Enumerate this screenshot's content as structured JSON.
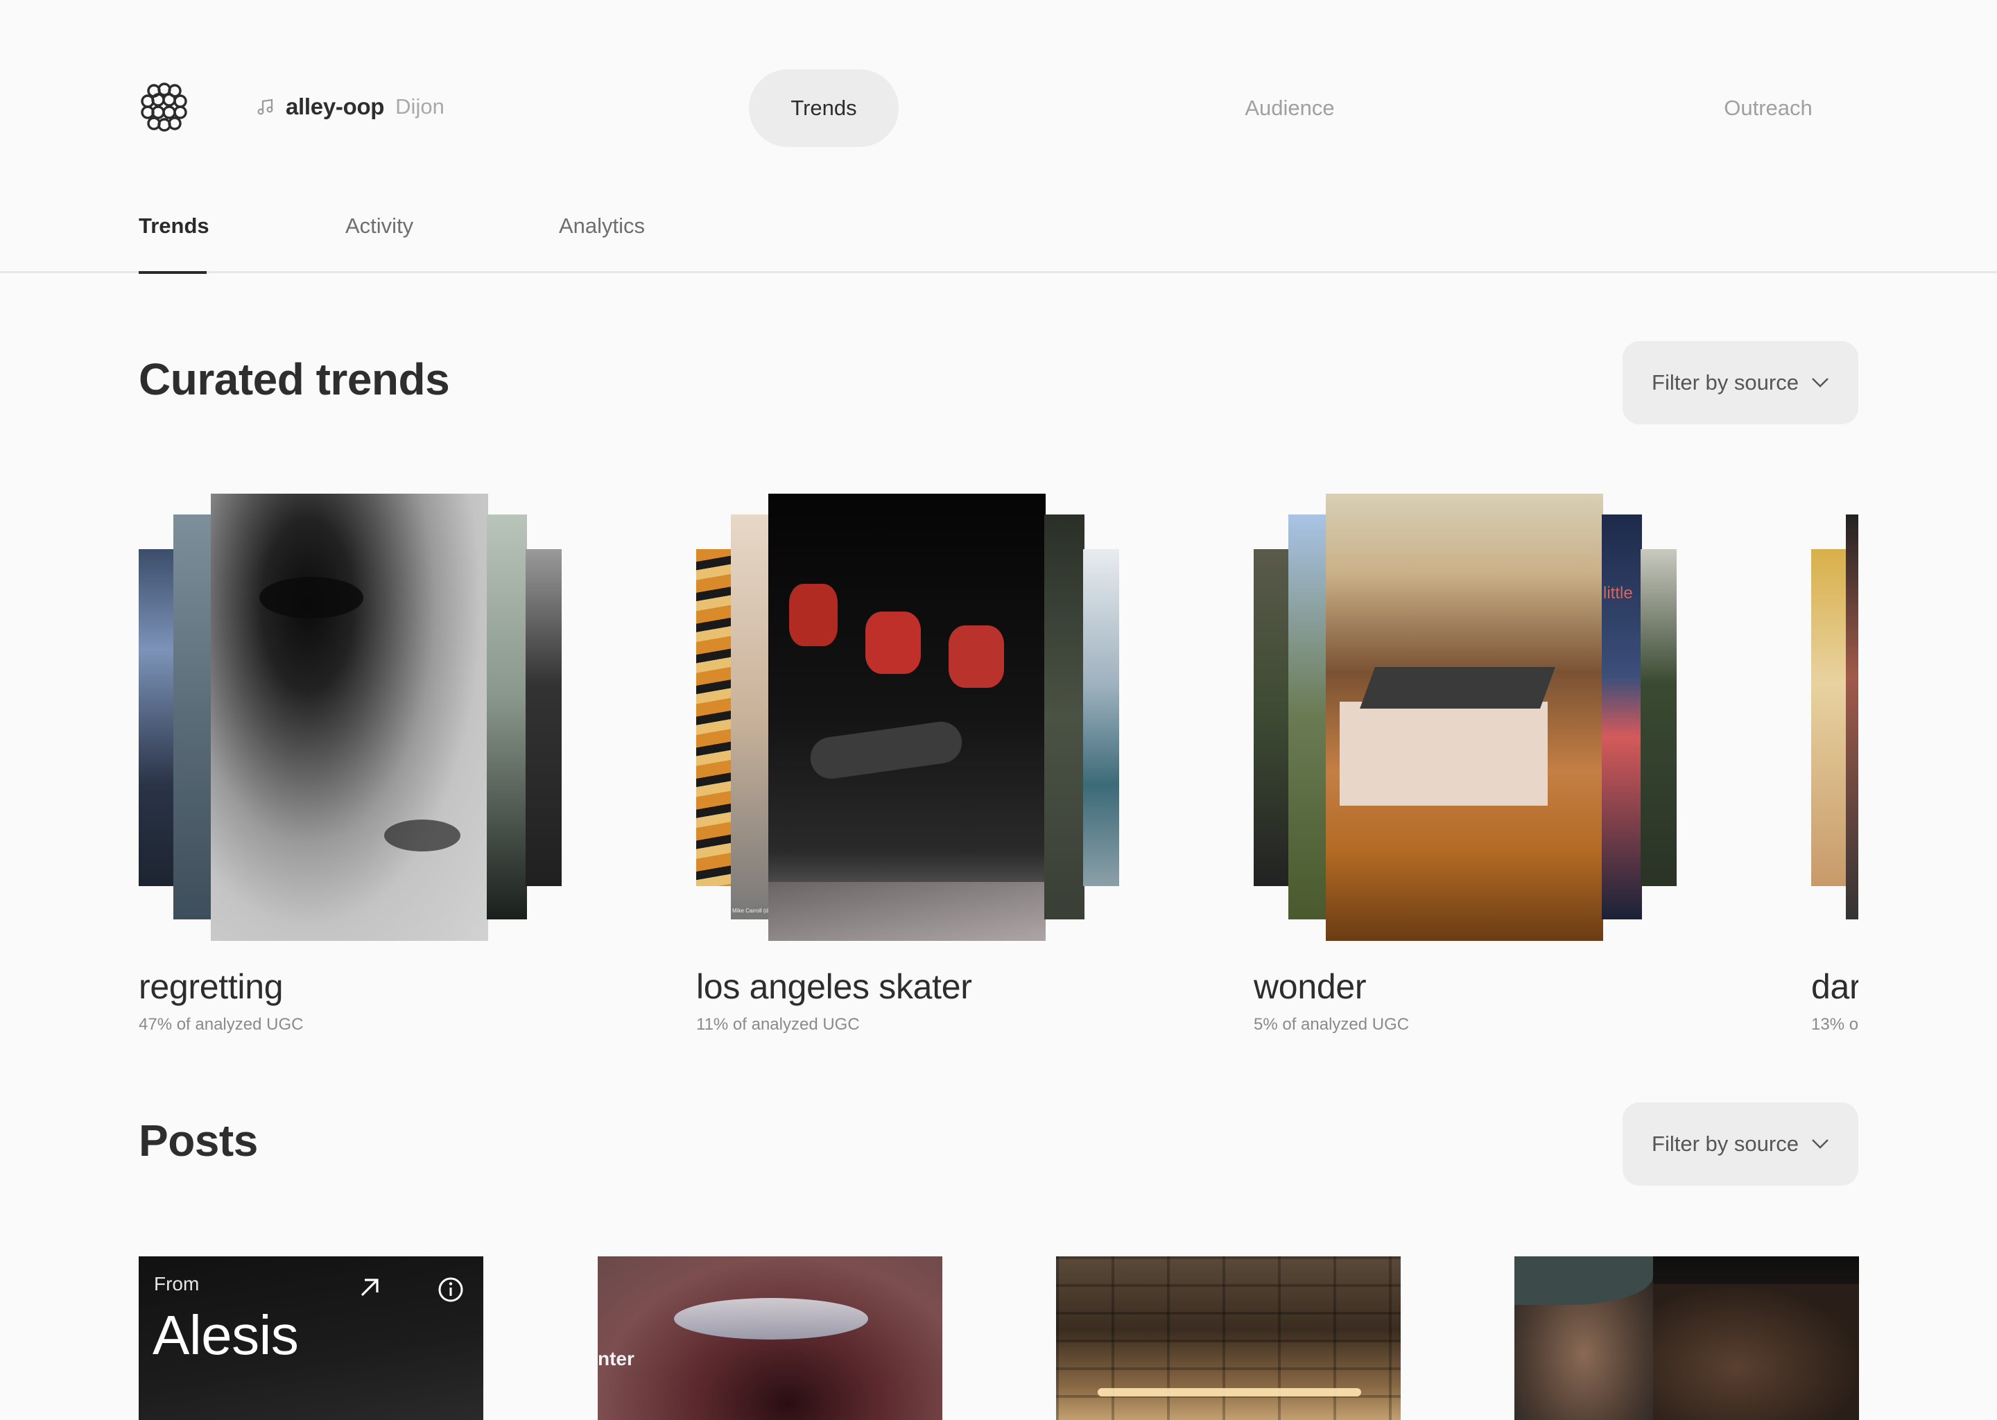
{
  "header": {
    "song_title": "alley-oop",
    "song_artist": "Dijon",
    "nav": [
      "Trends",
      "Audience",
      "Outreach"
    ],
    "active_nav": "Trends"
  },
  "subtabs": {
    "items": [
      "Trends",
      "Activity",
      "Analytics"
    ],
    "active": "Trends"
  },
  "curated": {
    "title": "Curated trends",
    "filter_label": "Filter by source",
    "trends": [
      {
        "name": "regretting",
        "stat": "47% of analyzed UGC"
      },
      {
        "name": "los angeles skater",
        "stat": "11% of analyzed UGC"
      },
      {
        "name": "wonder",
        "stat": "5% of analyzed UGC"
      },
      {
        "name": "dar",
        "stat": "13% o"
      }
    ],
    "overlay_text": [
      "little",
      "Mike Carroll (dd)"
    ]
  },
  "posts": {
    "title": "Posts",
    "filter_label": "Filter by source",
    "items": [
      {
        "from_label": "From",
        "name": "Alesis"
      },
      {
        "caption": "nter"
      },
      {},
      {}
    ]
  }
}
